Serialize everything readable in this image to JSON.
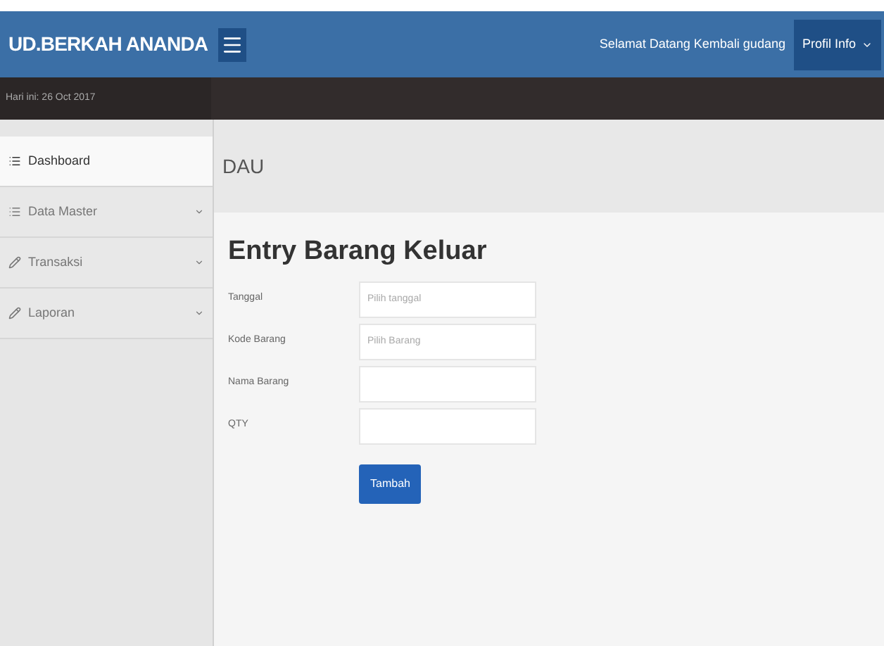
{
  "brand": "UD.BERKAH ANANDA",
  "greeting": "Selamat Datang Kembali gudang",
  "profile_button": "Profil Info",
  "date": "Hari ini: 26 Oct 2017",
  "sidebar": {
    "items": [
      {
        "label": "Dashboard",
        "kind": "list",
        "has_submenu": false,
        "selected": true
      },
      {
        "label": "Data Master",
        "kind": "list",
        "has_submenu": true,
        "selected": false
      },
      {
        "label": "Transaksi",
        "kind": "edit",
        "has_submenu": true,
        "selected": false
      },
      {
        "label": "Laporan",
        "kind": "edit",
        "has_submenu": true,
        "selected": false
      }
    ]
  },
  "page_header": "DAU",
  "form": {
    "title": "Entry Barang Keluar",
    "fields": [
      {
        "label": "Tanggal",
        "placeholder": "Pilih tanggal"
      },
      {
        "label": "Kode Barang",
        "placeholder": "Pilih Barang"
      },
      {
        "label": "Nama Barang"
      },
      {
        "label": "QTY"
      }
    ],
    "submit": "Tambah"
  }
}
